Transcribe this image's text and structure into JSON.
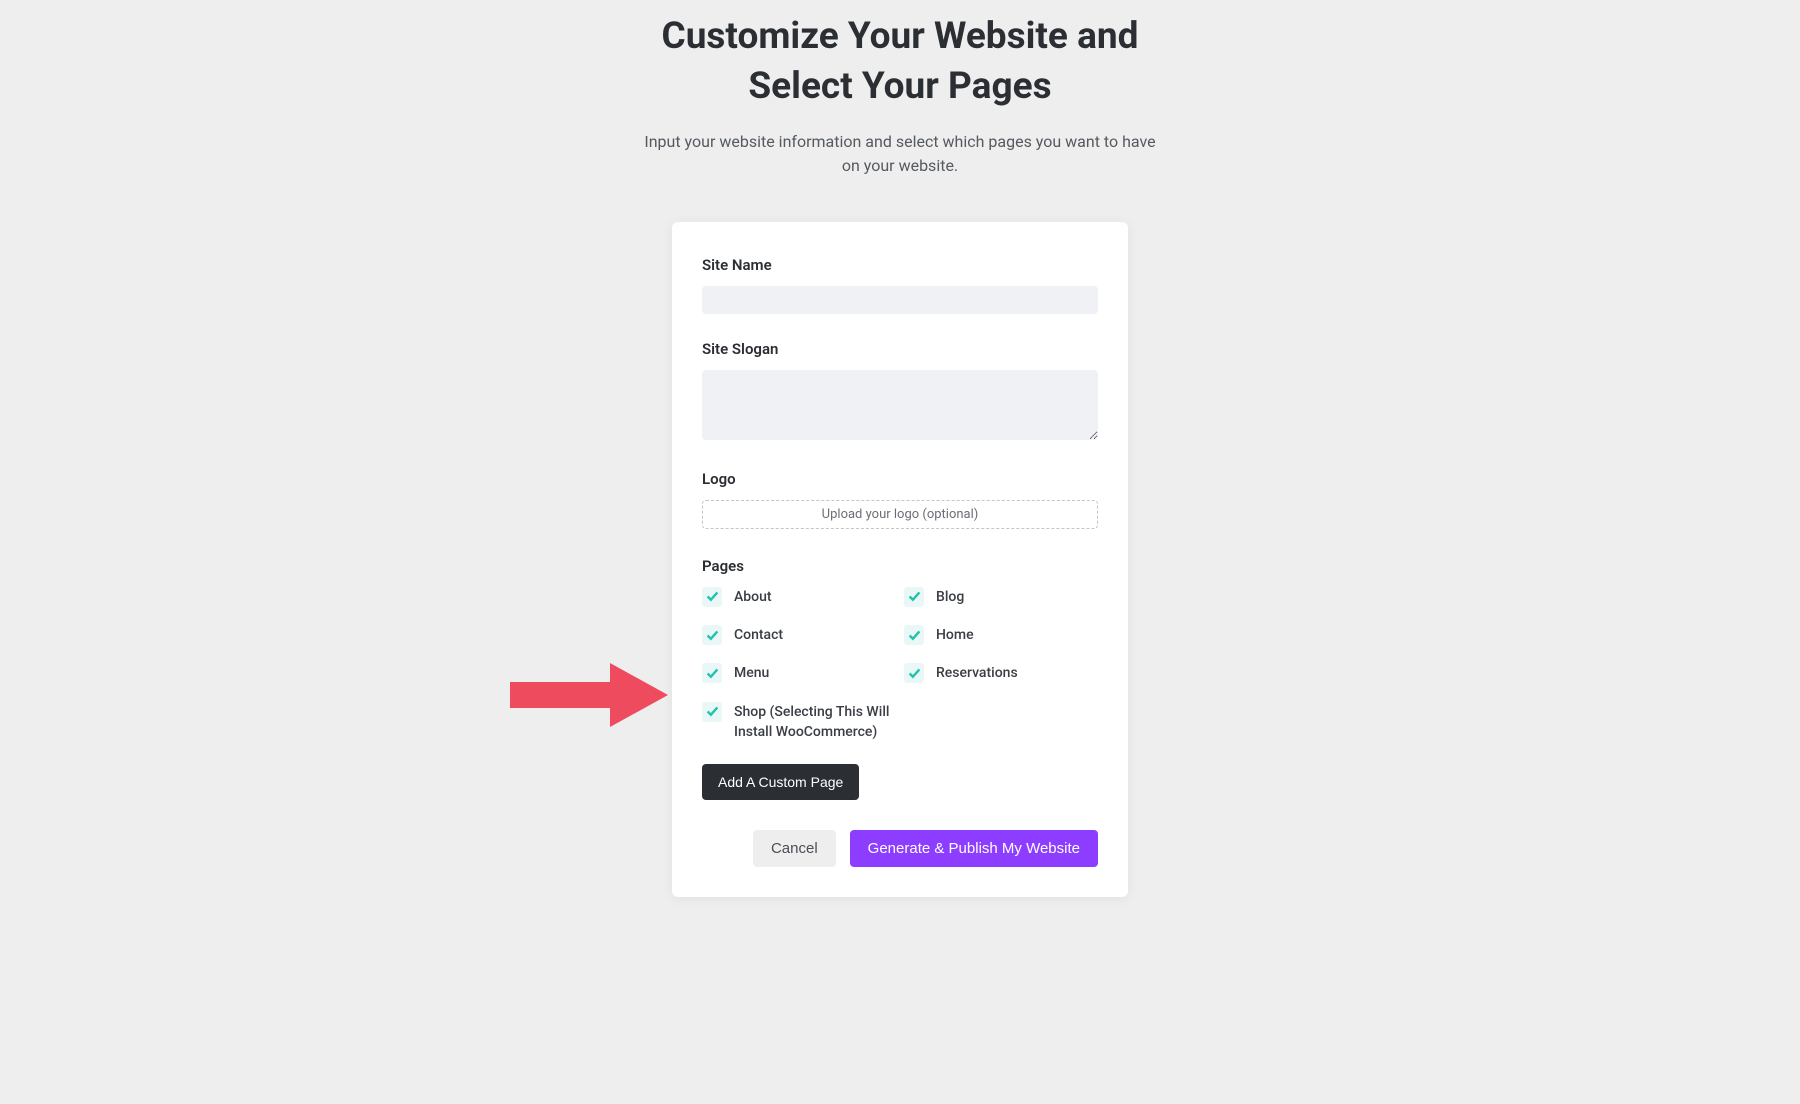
{
  "header": {
    "title_line1": "Customize Your Website and",
    "title_line2": "Select Your Pages",
    "subtitle": "Input your website information and select which pages you want to have on your website."
  },
  "form": {
    "site_name": {
      "label": "Site Name",
      "value": ""
    },
    "site_slogan": {
      "label": "Site Slogan",
      "value": ""
    },
    "logo": {
      "label": "Logo",
      "upload_text": "Upload your logo (optional)"
    },
    "pages": {
      "label": "Pages",
      "items": [
        {
          "label": "About",
          "checked": true
        },
        {
          "label": "Blog",
          "checked": true
        },
        {
          "label": "Contact",
          "checked": true
        },
        {
          "label": "Home",
          "checked": true
        },
        {
          "label": "Menu",
          "checked": true
        },
        {
          "label": "Reservations",
          "checked": true
        },
        {
          "label": "Shop (Selecting This Will Install WooCommerce)",
          "checked": true
        }
      ]
    },
    "add_custom_page_label": "Add A Custom Page"
  },
  "actions": {
    "cancel_label": "Cancel",
    "publish_label": "Generate & Publish My Website"
  },
  "annotation": {
    "arrow_color": "#ef4b5e"
  }
}
